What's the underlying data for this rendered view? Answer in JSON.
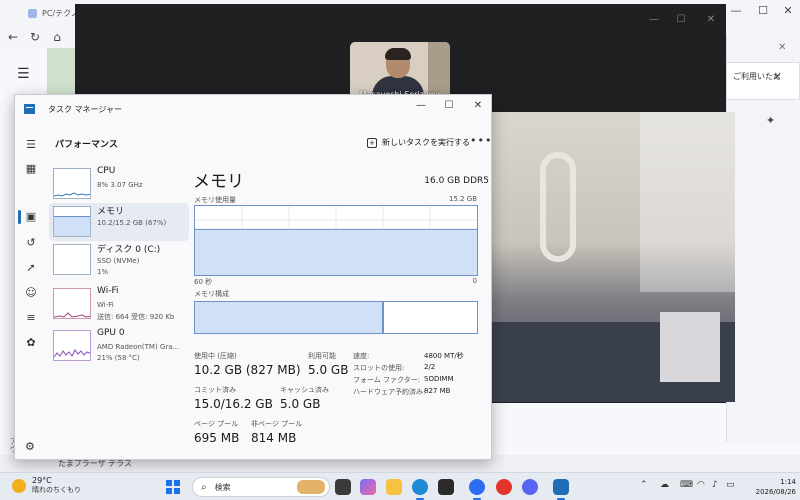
{
  "browser": {
    "tab_title": "PC/テクノ",
    "notice_text": "ご利用いただ",
    "bottom_text": "たまプラーザ テラス",
    "side_text": "アウ"
  },
  "video": {
    "participant_name": "Masayoshi Serizawa"
  },
  "task_manager": {
    "title": "タスク マネージャー",
    "section": "パフォーマンス",
    "new_task": "新しいタスクを実行する",
    "resources": [
      {
        "name": "CPU",
        "sub1": "8%  3.07 GHz",
        "sub2": ""
      },
      {
        "name": "メモリ",
        "sub1": "10.2/15.2 GB (67%)",
        "sub2": ""
      },
      {
        "name": "ディスク 0 (C:)",
        "sub1": "SSD (NVMe)",
        "sub2": "1%"
      },
      {
        "name": "Wi-Fi",
        "sub1": "Wi-Fi",
        "sub2": "送信: 664  受信: 920 Kb"
      },
      {
        "name": "GPU 0",
        "sub1": "AMD Radeon(TM) Gra...",
        "sub2": "21%  (58 °C)"
      }
    ],
    "memory": {
      "title": "メモリ",
      "total": "16.0 GB DDR5",
      "usage_label": "メモリ使用量",
      "usage_max": "15.2 GB",
      "time_label": "60 秒",
      "zero_label": "0",
      "usage_fraction": 0.67,
      "composition_label": "メモリ構成",
      "composition_used_fraction": 0.67,
      "stats": {
        "in_use_label": "使用中 (圧縮)",
        "in_use_value": "10.2 GB (827 MB)",
        "available_label": "利用可能",
        "available_value": "5.0 GB",
        "committed_label": "コミット済み",
        "committed_value": "15.0/16.2 GB",
        "cached_label": "キャッシュ済み",
        "cached_value": "5.0 GB",
        "paged_label": "ページ プール",
        "paged_value": "695 MB",
        "nonpaged_label": "非ページ プール",
        "nonpaged_value": "814 MB"
      },
      "details": [
        {
          "k": "速度:",
          "v": "4800 MT/秒"
        },
        {
          "k": "スロットの使用:",
          "v": "2/2"
        },
        {
          "k": "フォーム ファクター:",
          "v": "SODIMM"
        },
        {
          "k": "ハードウェア予約済み:",
          "v": "827 MB"
        }
      ]
    }
  },
  "taskbar": {
    "temperature": "29°C",
    "weather": "晴れのちくもり",
    "search_placeholder": "検索",
    "time": "1:14",
    "date": "2026/08/26",
    "colors": {
      "accent": "#1a73e8",
      "sun": "#f2b01e"
    }
  }
}
